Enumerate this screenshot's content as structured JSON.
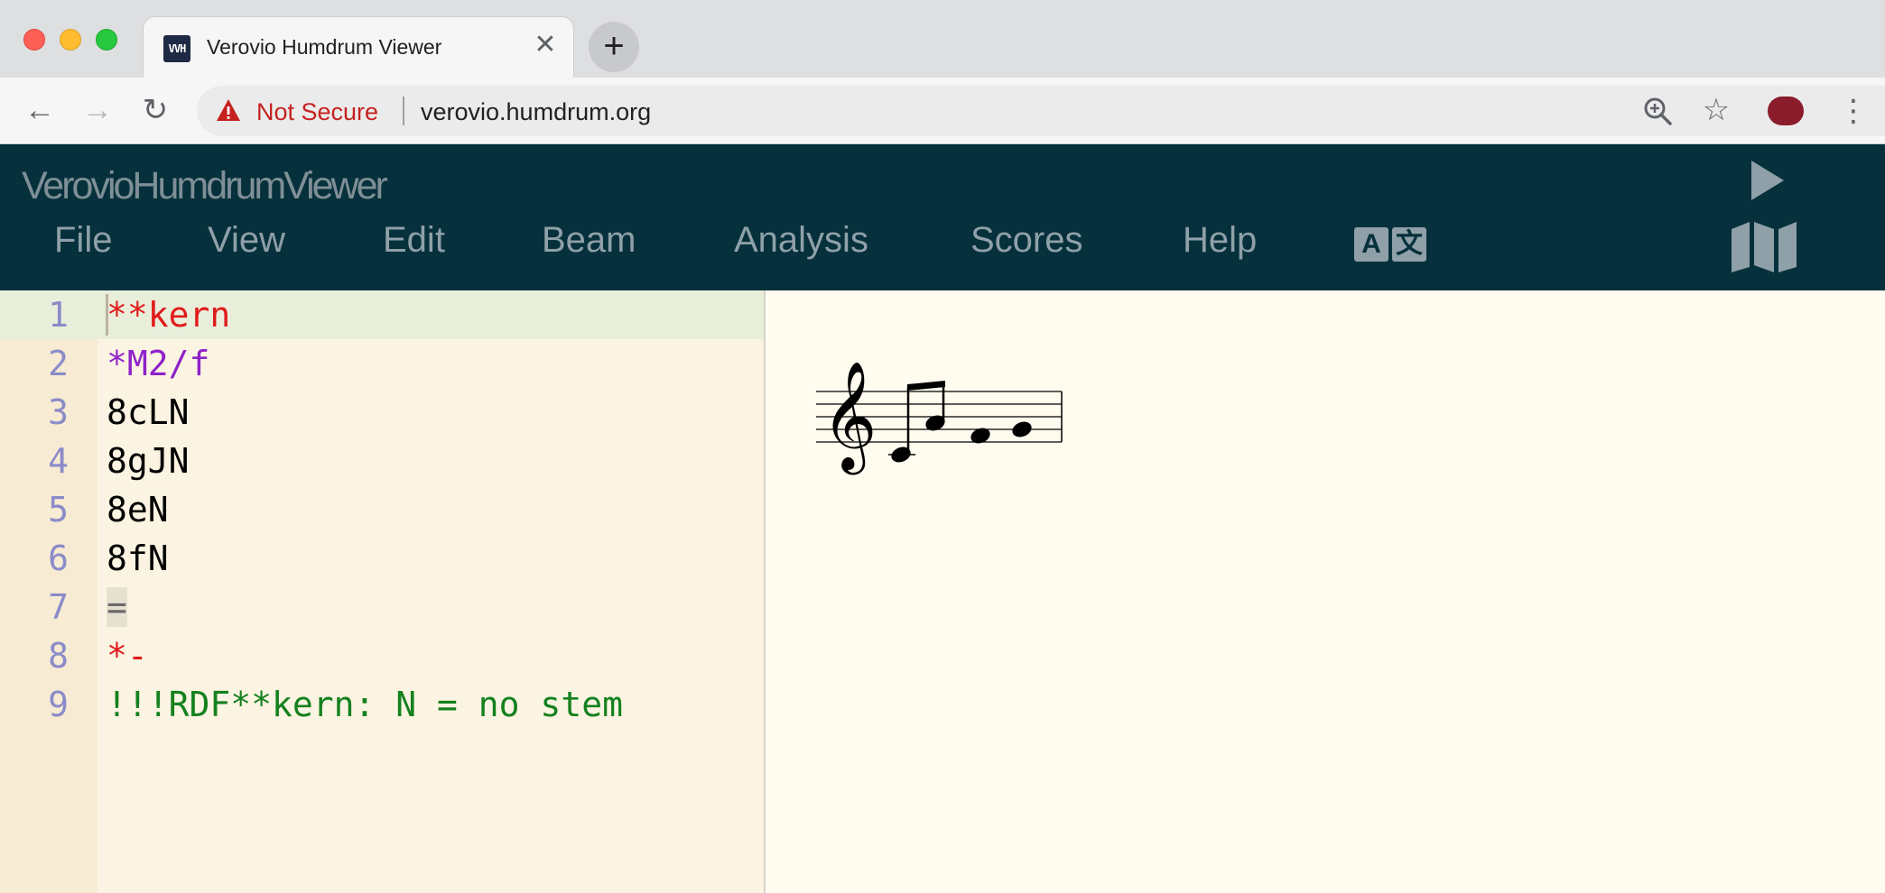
{
  "browser": {
    "tab": {
      "title": "Verovio Humdrum Viewer",
      "favicon_text": "VVH",
      "close": "✕"
    },
    "new_tab": "+",
    "nav": {
      "back": "←",
      "forward": "→",
      "reload": "↻"
    },
    "omnibox": {
      "security_label": "Not Secure",
      "url": "verovio.humdrum.org"
    },
    "icons": [
      "warning-icon",
      "zoom-icon",
      "star-icon",
      "profile-icon",
      "kebab-menu-icon"
    ],
    "colors": {
      "tabstrip": "#dedfe1",
      "not_secure": "#c5221f"
    }
  },
  "app": {
    "title": "VerovioHumdrumViewer",
    "menu": [
      "File",
      "View",
      "Edit",
      "Beam",
      "Analysis",
      "Scores",
      "Help"
    ],
    "lang_icon": {
      "a": "A",
      "b": "文"
    },
    "colors": {
      "header_bg": "#05303c",
      "menu_text": "#8fa0a8"
    }
  },
  "editor": {
    "lines": [
      {
        "num": "1",
        "text": "**kern",
        "color": "#e01b1b"
      },
      {
        "num": "2",
        "text": "*M2/f",
        "color": "#8e22c9"
      },
      {
        "num": "3",
        "text": "8cLN",
        "color": "#000000"
      },
      {
        "num": "4",
        "text": "8gJN",
        "color": "#000000"
      },
      {
        "num": "5",
        "text": "8eN",
        "color": "#000000"
      },
      {
        "num": "6",
        "text": "8fN",
        "color": "#000000"
      },
      {
        "num": "7",
        "text": "=",
        "color": "#6a6a6a"
      },
      {
        "num": "8",
        "text": "*-",
        "color": "#e01b1b"
      },
      {
        "num": "9",
        "text": "!!!RDF**kern: N = no stem",
        "color": "#14811e"
      }
    ],
    "active_line": "1"
  },
  "notation": {
    "clef": "treble",
    "notes": [
      "c",
      "g",
      "e",
      "f"
    ],
    "durations": [
      "8",
      "8",
      "8",
      "8"
    ]
  }
}
